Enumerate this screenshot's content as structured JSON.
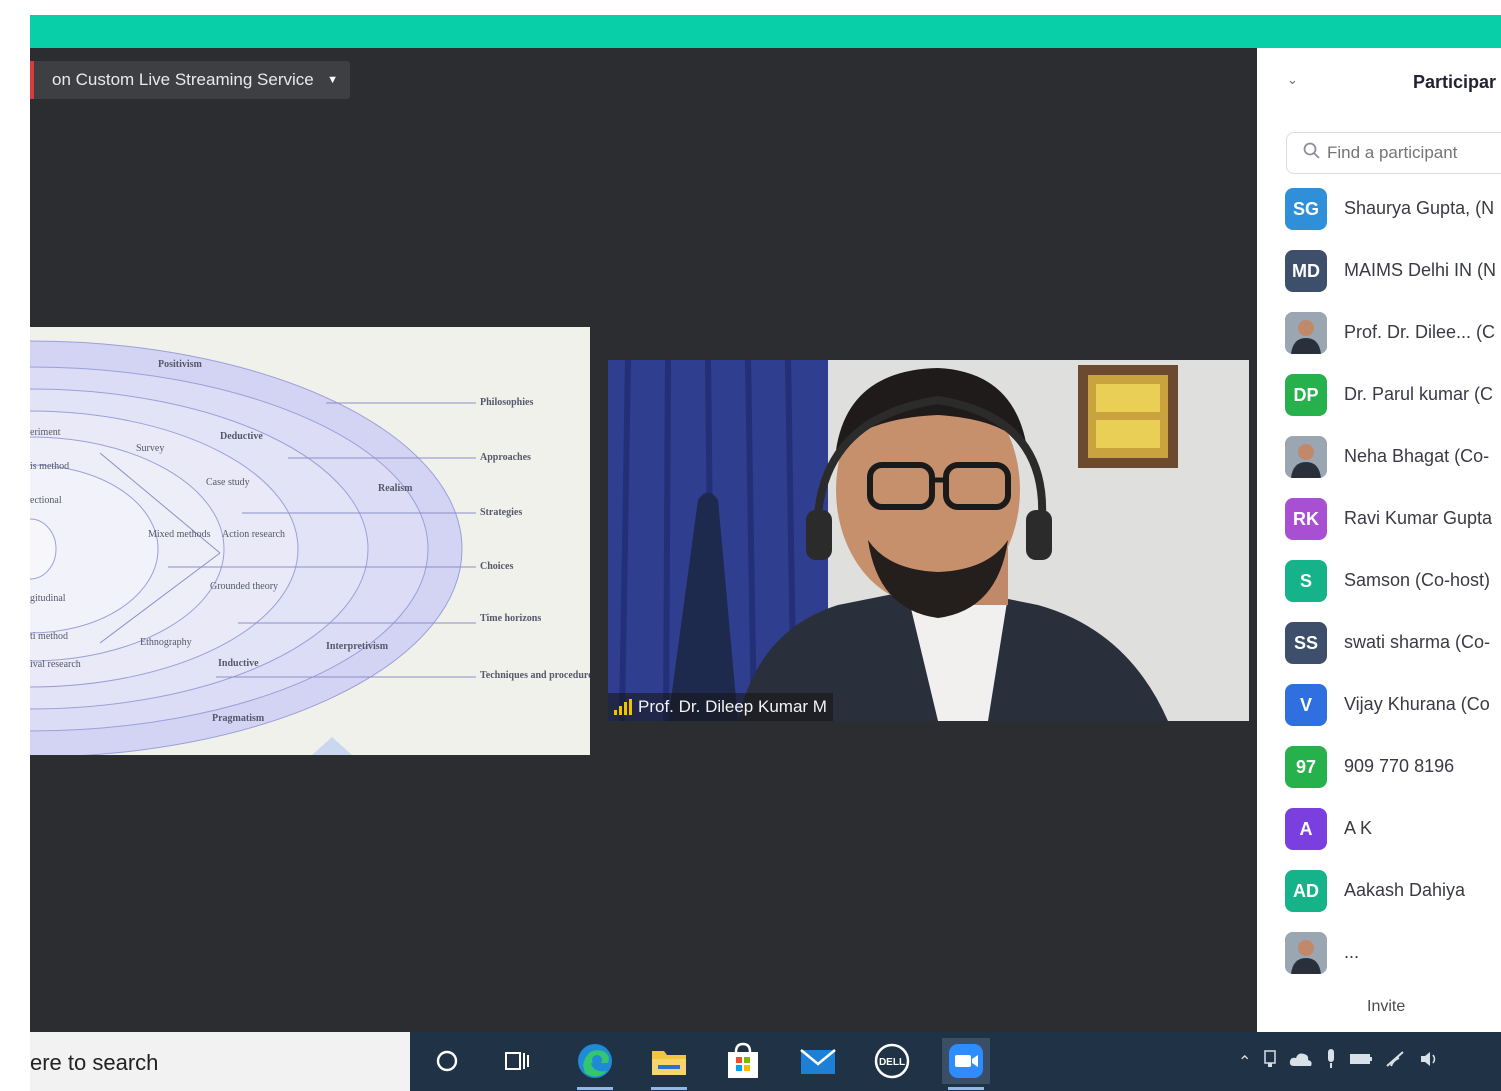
{
  "stream_menu": {
    "label": "on Custom Live Streaming Service",
    "caret": "▼"
  },
  "slide": {
    "ring_labels": [
      "Positivism",
      "Deductive",
      "Realism",
      "Interpretivism",
      "Inductive",
      "Pragmatism"
    ],
    "inner_labels": [
      "Survey",
      "Case study",
      "Mixed methods",
      "Action research",
      "Grounded theory",
      "Ethnography"
    ],
    "left_labels": [
      "eriment",
      "is method",
      "ectional",
      "gitudinal",
      "ti method",
      "ival research"
    ],
    "right_labels": [
      "Philosophies",
      "Approaches",
      "Strategies",
      "Choices",
      "Time horizons",
      "Techniques and procedures"
    ]
  },
  "video": {
    "speaker_name": "Prof. Dr. Dileep Kumar M"
  },
  "participants_panel": {
    "title": "Participar",
    "collapse_icon": "chevron-down-icon",
    "search_placeholder": "Find a participant",
    "participants": [
      {
        "initials": "SG",
        "name": "Shaurya Gupta, (N",
        "color": "#2f8fd8"
      },
      {
        "initials": "MD",
        "name": "MAIMS Delhi IN (N",
        "color": "#3d4f6b"
      },
      {
        "initials": "",
        "name": "Prof. Dr. Dilee... (C",
        "color": "#6b7a88",
        "photo": true
      },
      {
        "initials": "DP",
        "name": "Dr. Parul kumar (C",
        "color": "#27b14c"
      },
      {
        "initials": "",
        "name": "Neha Bhagat (Co-",
        "color": "#d9a48a",
        "photo": true
      },
      {
        "initials": "RK",
        "name": "Ravi Kumar Gupta",
        "color": "#a94fd1"
      },
      {
        "initials": "S",
        "name": "Samson (Co-host)",
        "color": "#16b38a"
      },
      {
        "initials": "SS",
        "name": "swati sharma (Co-",
        "color": "#3d4f6b"
      },
      {
        "initials": "V",
        "name": "Vijay Khurana (Co",
        "color": "#2f6fe0"
      },
      {
        "initials": "97",
        "name": "909 770 8196",
        "color": "#27b14c"
      },
      {
        "initials": "A",
        "name": "A K",
        "color": "#7b3fe0"
      },
      {
        "initials": "AD",
        "name": "Aakash Dahiya",
        "color": "#16b38a"
      },
      {
        "initials": "",
        "name": "...",
        "color": "#6b7a88",
        "photo": true
      }
    ],
    "invite_label": "Invite"
  },
  "taskbar": {
    "search_text": "ere to search",
    "apps": [
      "cortana-icon",
      "task-view-icon",
      "edge-icon",
      "file-explorer-icon",
      "store-icon",
      "mail-icon",
      "dell-icon",
      "zoom-icon"
    ],
    "tray_icons": [
      "chevron-up-icon",
      "network-icon",
      "cloud-icon",
      "mic-icon",
      "battery-icon",
      "wifi-icon",
      "volume-icon"
    ]
  }
}
